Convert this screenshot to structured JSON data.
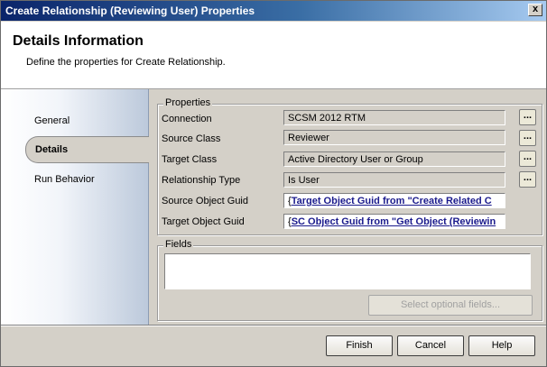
{
  "window": {
    "title": "Create Relationship (Reviewing User) Properties",
    "close_glyph": "x"
  },
  "header": {
    "title": "Details Information",
    "subtitle": "Define the properties for Create Relationship."
  },
  "nav": {
    "items": [
      {
        "label": "General",
        "selected": false
      },
      {
        "label": "Details",
        "selected": true
      },
      {
        "label": "Run Behavior",
        "selected": false
      }
    ]
  },
  "properties": {
    "group_label": "Properties",
    "rows": [
      {
        "label": "Connection",
        "value": "SCSM 2012 RTM",
        "browse": "..."
      },
      {
        "label": "Source Class",
        "value": "Reviewer",
        "browse": "..."
      },
      {
        "label": "Target Class",
        "value": "Active Directory User or Group",
        "browse": "..."
      },
      {
        "label": "Relationship Type",
        "value": "Is User",
        "browse": "..."
      },
      {
        "label": "Source Object Guid",
        "value_prefix": "{",
        "value": "Target Object Guid from \"Create Related C"
      },
      {
        "label": "Target Object Guid",
        "value_prefix": "{",
        "value": "SC Object Guid from \"Get Object (Reviewin"
      }
    ]
  },
  "fields": {
    "group_label": "Fields",
    "select_button": "Select optional fields..."
  },
  "buttons": {
    "finish": "Finish",
    "cancel": "Cancel",
    "help": "Help"
  }
}
